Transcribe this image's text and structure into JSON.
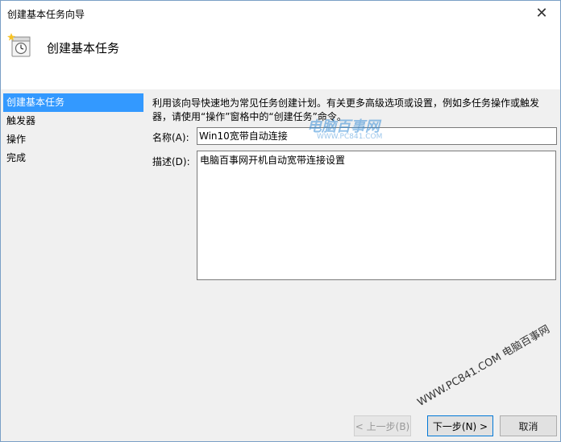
{
  "window": {
    "title": "创建基本任务向导",
    "close_glyph": "✕"
  },
  "header": {
    "title": "创建基本任务"
  },
  "sidebar": {
    "items": [
      {
        "label": "创建基本任务"
      },
      {
        "label": "触发器"
      },
      {
        "label": "操作"
      },
      {
        "label": "完成"
      }
    ]
  },
  "main": {
    "description": "利用该向导快速地为常见任务创建计划。有关更多高级选项或设置，例如多任务操作或触发器，请使用“操作”窗格中的“创建任务”命令。",
    "name_label": "名称(A):",
    "name_value": "Win10宽带自动连接",
    "desc_label": "描述(D):",
    "desc_value": "电脑百事网开机自动宽带连接设置"
  },
  "watermark": {
    "logo": "电脑百事网",
    "logo_sub": "WWW.PC841.COM",
    "diagonal": "WWW.PC841.COM 电脑百事网"
  },
  "footer": {
    "prev_label": "< 上一步(B)",
    "next_label": "下一步(N) >",
    "cancel_label": "取消"
  }
}
